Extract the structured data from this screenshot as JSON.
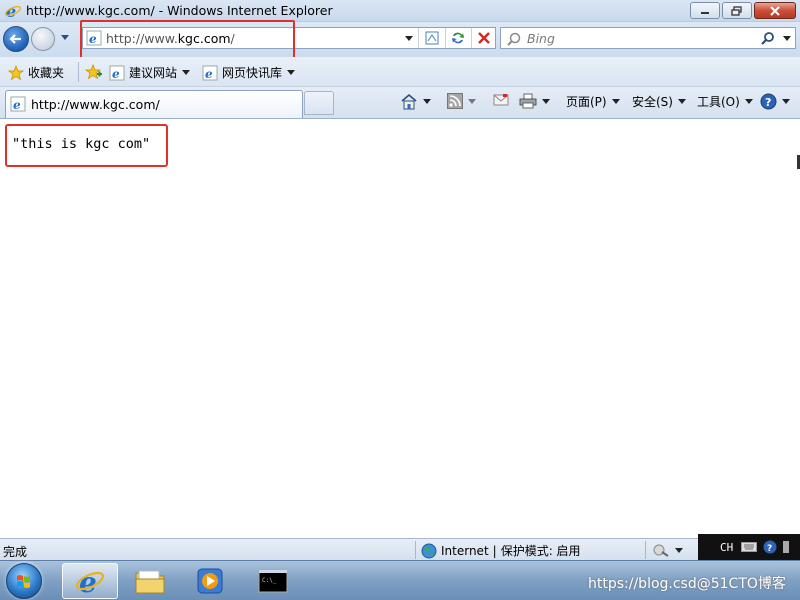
{
  "window": {
    "title": "http://www.kgc.com/ - Windows Internet Explorer"
  },
  "navigation": {
    "address_scheme": "http://www.",
    "address_host": "kgc.com",
    "address_tail": "/",
    "search_placeholder": "Bing"
  },
  "favorites_bar": {
    "favorites_label": "收藏夹",
    "items": [
      {
        "label": "建议网站",
        "icon": "ie-page-icon"
      },
      {
        "label": "网页快讯库",
        "icon": "ie-page-icon"
      }
    ]
  },
  "tabs": [
    {
      "label": "http://www.kgc.com/",
      "active": true
    }
  ],
  "command_bar": {
    "page": "页面(P)",
    "safety": "安全(S)",
    "tools": "工具(O)"
  },
  "content": {
    "text": "\"this is kgc com\""
  },
  "status_bar": {
    "status": "完成",
    "zone": "Internet",
    "protected_mode": "保护模式: 启用",
    "separator": "|"
  },
  "taskbar": {
    "tray_lang": "CH",
    "watermark": "https://blog.csd@51CTO博客"
  },
  "colors": {
    "highlight": "#e0302a",
    "ie_blue": "#1e6fd0"
  }
}
